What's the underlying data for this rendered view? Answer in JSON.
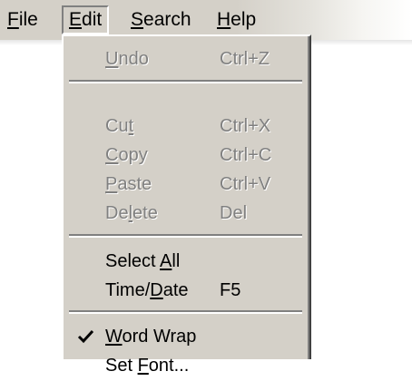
{
  "menubar": {
    "items": [
      {
        "pre": "",
        "accel": "F",
        "post": "ile"
      },
      {
        "pre": "",
        "accel": "E",
        "post": "dit"
      },
      {
        "pre": "",
        "accel": "S",
        "post": "earch"
      },
      {
        "pre": "",
        "accel": "H",
        "post": "elp"
      }
    ]
  },
  "edit_menu": {
    "undo": {
      "pre": "",
      "accel": "U",
      "post": "ndo",
      "shortcut": "Ctrl+Z"
    },
    "cut": {
      "pre": "Cu",
      "accel": "t",
      "post": "",
      "shortcut": "Ctrl+X"
    },
    "copy": {
      "pre": "",
      "accel": "C",
      "post": "opy",
      "shortcut": "Ctrl+C"
    },
    "paste": {
      "pre": "",
      "accel": "P",
      "post": "aste",
      "shortcut": "Ctrl+V"
    },
    "delete": {
      "pre": "De",
      "accel": "l",
      "post": "ete",
      "shortcut": "Del"
    },
    "select_all": {
      "pre": "Select ",
      "accel": "A",
      "post": "ll"
    },
    "time_date": {
      "pre": "Time/",
      "accel": "D",
      "post": "ate",
      "shortcut": "F5"
    },
    "word_wrap": {
      "pre": "",
      "accel": "W",
      "post": "ord Wrap"
    },
    "set_font": {
      "pre": "Set ",
      "accel": "F",
      "post": "ont..."
    }
  },
  "colors": {
    "menu_face": "#d4d0c8",
    "disabled_text": "#808080",
    "highlight": "#ffffff",
    "shadow": "#808080"
  },
  "state": {
    "open_menu": "Edit",
    "word_wrap_checked": true
  }
}
